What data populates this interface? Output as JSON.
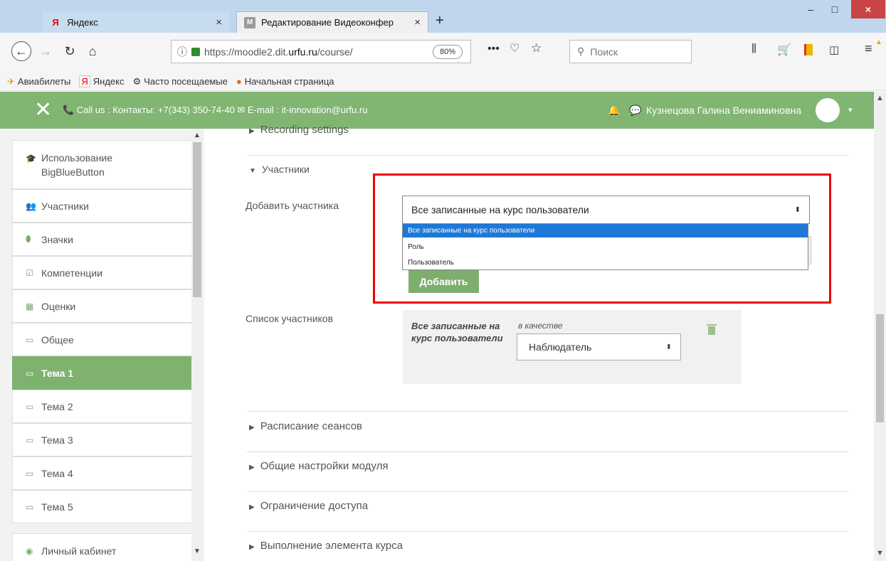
{
  "browser": {
    "tabs": [
      {
        "label": "Яндекс",
        "icon": "yandex-icon",
        "close": "×"
      },
      {
        "label": "Редактирование Видеоконфер",
        "icon": "moodle-icon",
        "close": "×"
      }
    ],
    "new_tab": "+",
    "window_controls": {
      "minimize": "–",
      "maximize": "□",
      "close": "×"
    },
    "nav": {
      "back": "←",
      "forward": "→",
      "reload": "↻",
      "home": "⌂"
    },
    "url": {
      "info": "ⓘ",
      "prefix": "https://moodle2.dit.",
      "domain": "urfu.ru",
      "suffix": "/course/"
    },
    "zoom": "80%",
    "more": "•••",
    "pocket": "♡",
    "star": "☆",
    "search_placeholder": "Поиск",
    "search_icon": "search-icon",
    "library": "⫼",
    "cart": "🛒",
    "sidebar_toggle": "◫",
    "menu": "≡",
    "menu_warn": "▲",
    "bookmarks": [
      {
        "label": "Авиабилеты",
        "icon": "✈"
      },
      {
        "label": "Яндекс",
        "icon": "Я"
      },
      {
        "label": "Часто посещаемые",
        "icon": "⚙"
      },
      {
        "label": "Начальная страница",
        "icon": "●"
      }
    ]
  },
  "header": {
    "close": "✕",
    "contact": "📞 Call us : Контакты: +7(343) 350-74-40 ✉ E-mail : it-innovation@urfu.ru",
    "bell": "🔔",
    "chat": "💬",
    "user": "Кузнецова Галина Вениаминовна",
    "caret": "▾"
  },
  "sidebar": {
    "scroll_up": "▲",
    "scroll_down": "▼",
    "items": [
      {
        "label": "Использование BigBlueButton",
        "icon": "🎓"
      },
      {
        "label": "Участники",
        "icon": "👥"
      },
      {
        "label": "Значки",
        "icon": "⬮"
      },
      {
        "label": "Компетенции",
        "icon": "☑"
      },
      {
        "label": "Оценки",
        "icon": "▦"
      },
      {
        "label": "Общее",
        "icon": "▭"
      },
      {
        "label": "Тема 1",
        "icon": "▭",
        "active": true
      },
      {
        "label": "Тема 2",
        "icon": "▭"
      },
      {
        "label": "Тема 3",
        "icon": "▭"
      },
      {
        "label": "Тема 4",
        "icon": "▭"
      },
      {
        "label": "Тема 5",
        "icon": "▭"
      },
      {
        "label": "Личный кабинет",
        "icon": "◉"
      }
    ]
  },
  "form": {
    "sections": {
      "recording": "Recording settings",
      "participants": "Участники",
      "schedule": "Расписание сеансов",
      "general": "Общие настройки модуля",
      "access": "Ограничение доступа",
      "completion": "Выполнение элемента курса"
    },
    "add_participant_label": "Добавить участника",
    "select_value": "Все записанные на курс пользователи",
    "select_arrow": "⬍",
    "options": [
      "Все записанные на курс пользователи",
      "Роль",
      "Пользователь"
    ],
    "add_button": "Добавить",
    "participant_list_label": "Список участников",
    "participant_name": "Все записанные на курс пользователи",
    "as_label": "в качестве",
    "role_value": "Наблюдатель"
  },
  "page": {
    "scroll_up": "▲",
    "scroll_down": "▼"
  }
}
